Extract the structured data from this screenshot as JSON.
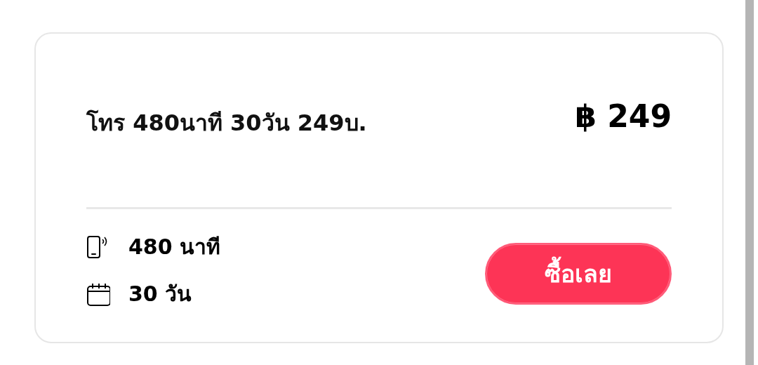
{
  "package": {
    "title": "โทร 480นาที 30วัน 249บ.",
    "price": "฿ 249",
    "features": [
      {
        "kind": "calls",
        "text": "480 นาที"
      },
      {
        "kind": "days",
        "text": "30 วัน"
      }
    ],
    "buy_button": "ซื้อเลย"
  }
}
